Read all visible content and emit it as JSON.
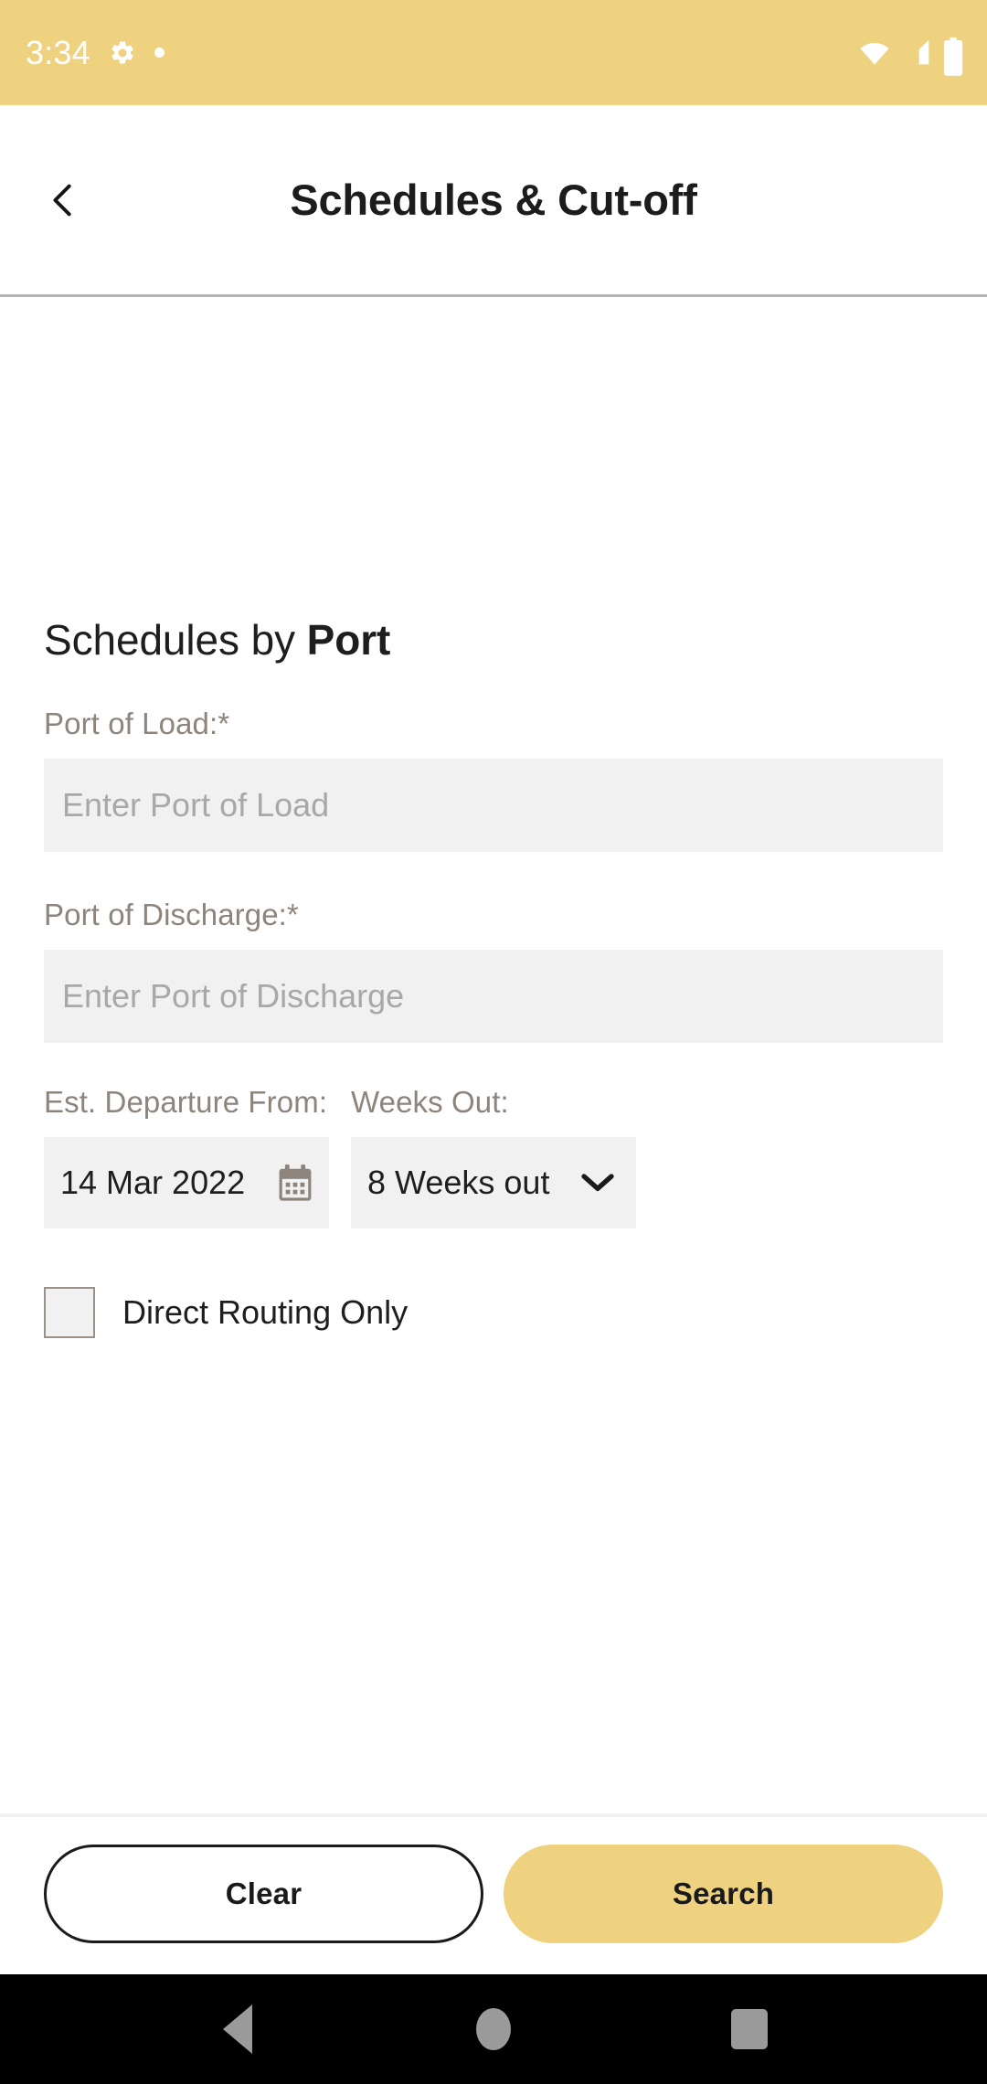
{
  "status_bar": {
    "time": "3:34",
    "icons_left": [
      "gear-icon",
      "dot-indicator"
    ],
    "icons_right": [
      "wifi-icon",
      "cellular-signal-icon",
      "battery-icon"
    ],
    "background_color": "#efd27f"
  },
  "app_bar": {
    "back_icon": "chevron-left-icon",
    "title": "Schedules & Cut-off"
  },
  "main": {
    "heading_prefix": "Schedules by ",
    "heading_emphasis": "Port",
    "fields": {
      "port_of_load": {
        "label": "Port of Load:*",
        "placeholder": "Enter Port of Load",
        "value": ""
      },
      "port_of_discharge": {
        "label": "Port of Discharge:*",
        "placeholder": "Enter Port of Discharge",
        "value": ""
      },
      "departure_from": {
        "label": "Est. Departure From:",
        "value": "14 Mar 2022",
        "icon": "calendar-icon"
      },
      "weeks_out": {
        "label": "Weeks Out:",
        "value": "8 Weeks out",
        "icon": "chevron-down-icon"
      }
    },
    "checkbox": {
      "label": "Direct Routing Only",
      "checked": false
    }
  },
  "actions": {
    "clear_label": "Clear",
    "search_label": "Search",
    "search_color": "#efd27f"
  },
  "nav_bar": {
    "items": [
      "back-triangle-icon",
      "home-circle-icon",
      "recents-square-icon"
    ],
    "background_color": "#000000"
  }
}
